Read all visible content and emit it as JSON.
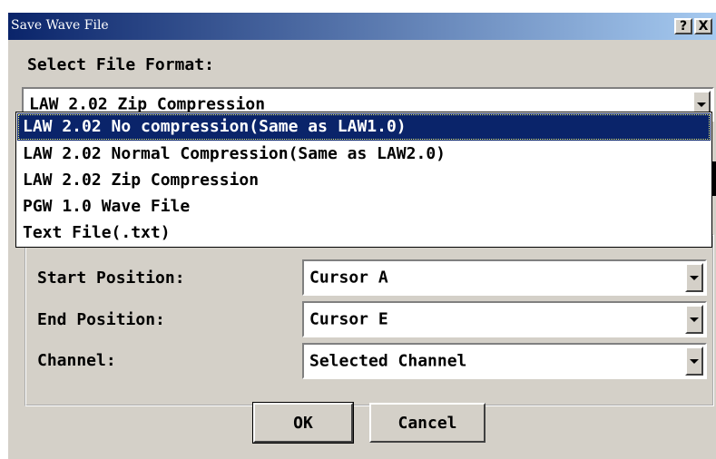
{
  "window": {
    "title": "Save Wave File",
    "help_button": "?",
    "close_button": "X"
  },
  "format": {
    "label": "Select File Format:",
    "selected": "LAW 2.02 Zip Compression",
    "options": [
      "LAW 2.02 No compression(Same as LAW1.0)",
      "LAW 2.02 Normal Compression(Same as LAW2.0)",
      "LAW 2.02 Zip Compression",
      "PGW 1.0 Wave File",
      "Text File(.txt)"
    ],
    "highlighted_index": 0
  },
  "fields": {
    "start_label": "Start Position:",
    "start_value": "Cursor A",
    "end_label": "End Position:",
    "end_value": "Cursor E",
    "channel_label": "Channel:",
    "channel_value": "Selected Channel"
  },
  "buttons": {
    "ok": "OK",
    "cancel": "Cancel"
  },
  "colors": {
    "title_start": "#0a246a",
    "title_end": "#a6caf0",
    "face": "#d4d0c8",
    "selection": "#0a246a"
  }
}
